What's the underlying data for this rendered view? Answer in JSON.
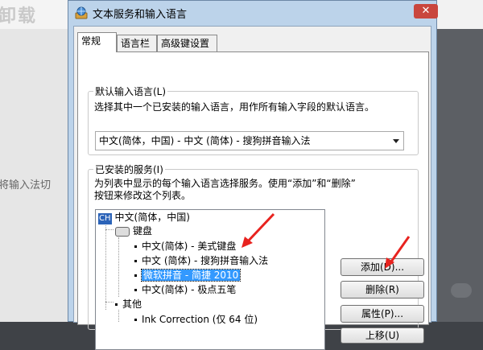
{
  "background": {
    "title": "卸载",
    "left_text": "将输入法切",
    "close_glyph": "✕"
  },
  "dialog": {
    "title": "文本服务和输入语言",
    "tabs": [
      {
        "label": "常规",
        "active": true
      },
      {
        "label": "语言栏",
        "active": false
      },
      {
        "label": "高级键设置",
        "active": false
      }
    ],
    "default_language": {
      "group_label": "默认输入语言(L)",
      "description": "选择其中一个已安装的输入语言，用作所有输入字段的默认语言。",
      "selected_value": "中文(简体，中国) - 中文 (简体) - 搜狗拼音输入法"
    },
    "installed_services": {
      "group_label": "已安装的服务(I)",
      "description_line1": "为列表中显示的每个输入语言选择服务。使用“添加”和“删除”",
      "description_line2": "按钮来修改这个列表。",
      "tree": {
        "language_code": "CH",
        "language": "中文(简体，中国)",
        "keyboard_label": "键盘",
        "keyboards": [
          "中文(简体) - 美式键盘",
          "中文 (简体) - 搜狗拼音输入法",
          "微软拼音 - 简捷 2010",
          "中文(简体) - 极点五笔"
        ],
        "selected_index": 2,
        "other_label": "其他",
        "other_items": [
          "Ink Correction (仅 64 位)"
        ]
      },
      "buttons": {
        "add": "添加(D)...",
        "remove": "删除(R)",
        "properties": "属性(P)...",
        "move_up": "上移(U)"
      }
    }
  },
  "colors": {
    "selection": "#3399ff",
    "annotation_arrow": "#e8231f",
    "language_badge": "#2b63b8"
  }
}
